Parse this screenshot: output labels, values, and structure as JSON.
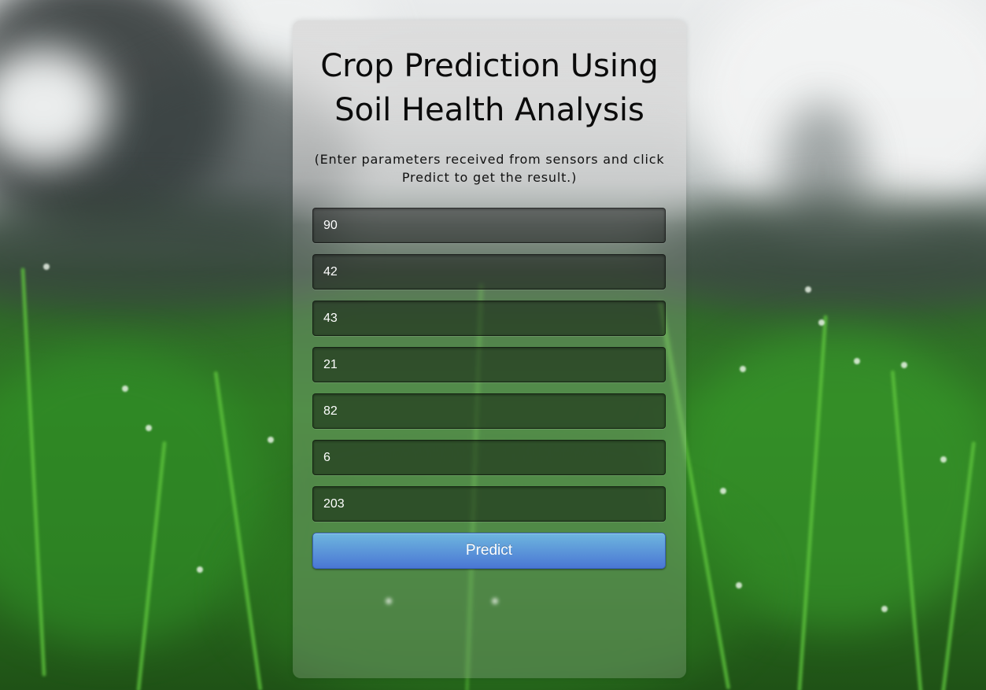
{
  "page": {
    "title": "Crop Prediction Using Soil Health Analysis",
    "subtitle": "(Enter parameters received from sensors and click Predict to get the result.)"
  },
  "form": {
    "fields": [
      {
        "value": "90"
      },
      {
        "value": "42"
      },
      {
        "value": "43"
      },
      {
        "value": "21"
      },
      {
        "value": "82"
      },
      {
        "value": "6"
      },
      {
        "value": "203"
      }
    ],
    "submit_label": "Predict"
  },
  "colors": {
    "button_top": "#6eb6de",
    "button_bottom": "#4a77d4",
    "field_text": "#ffffff"
  }
}
